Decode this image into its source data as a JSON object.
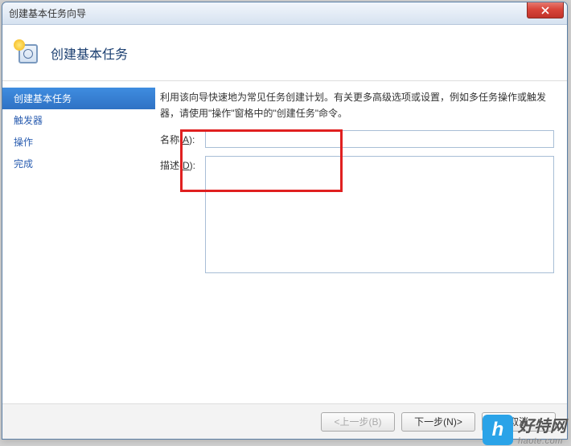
{
  "window": {
    "title": "创建基本任务向导"
  },
  "header": {
    "title": "创建基本任务"
  },
  "sidebar": {
    "items": [
      {
        "label": "创建基本任务",
        "active": true
      },
      {
        "label": "触发器",
        "active": false
      },
      {
        "label": "操作",
        "active": false
      },
      {
        "label": "完成",
        "active": false
      }
    ]
  },
  "main": {
    "instructions": "利用该向导快速地为常见任务创建计划。有关更多高级选项或设置，例如多任务操作或触发器，请使用\"操作\"窗格中的\"创建任务\"命令。",
    "name_label_prefix": "名称(",
    "name_label_key": "A",
    "name_label_suffix": "):",
    "name_value": "",
    "desc_label_prefix": "描述(",
    "desc_label_key": "D",
    "desc_label_suffix": "):",
    "desc_value": ""
  },
  "footer": {
    "back": "<上一步(B)",
    "next": "下一步(N)>",
    "cancel": "取消"
  },
  "watermark": {
    "logo_letter": "h",
    "cn": "好特网",
    "en": "haote.com"
  }
}
